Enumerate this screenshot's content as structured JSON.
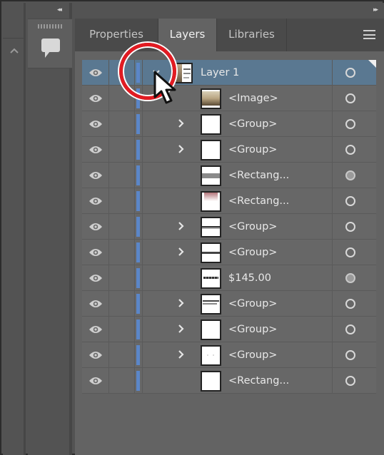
{
  "panel": {
    "collapse_left_icon": "double-chevron-left",
    "expand_right_icon": "double-chevron-right",
    "collapse_left_glyph": "◂◂",
    "expand_right_glyph": "▸▸"
  },
  "side": {
    "comment_icon": "speech-bubble-icon",
    "scroll_up_icon": "chevron-up-icon"
  },
  "tabs": [
    {
      "label": "Properties",
      "active": false
    },
    {
      "label": "Layers",
      "active": true
    },
    {
      "label": "Libraries",
      "active": false
    }
  ],
  "menu_icon": "hamburger-menu-icon",
  "colors": {
    "layer_color": "#5b86c8",
    "selected_row": "#5a7891",
    "callout_red": "#e21b22"
  },
  "layers": [
    {
      "name": "Layer 1",
      "level": "top",
      "expanded": true,
      "visible": true,
      "thumb": "composite",
      "target_filled": false,
      "selected": true
    },
    {
      "name": "<Image>",
      "level": "child",
      "has_children": false,
      "visible": true,
      "thumb": "photo",
      "target_filled": false
    },
    {
      "name": "<Group>",
      "level": "child",
      "has_children": true,
      "visible": true,
      "thumb": "blank",
      "target_filled": false
    },
    {
      "name": "<Group>",
      "level": "child",
      "has_children": true,
      "visible": true,
      "thumb": "blank",
      "target_filled": false
    },
    {
      "name": "<Rectang...",
      "level": "child",
      "has_children": false,
      "visible": true,
      "thumb": "gray-band",
      "target_filled": true
    },
    {
      "name": "<Rectang...",
      "level": "child",
      "has_children": false,
      "visible": true,
      "thumb": "red-gradient",
      "target_filled": false
    },
    {
      "name": "<Group>",
      "level": "child",
      "has_children": true,
      "visible": true,
      "thumb": "dark-line",
      "target_filled": false
    },
    {
      "name": "<Group>",
      "level": "child",
      "has_children": true,
      "visible": true,
      "thumb": "dark-line-2",
      "target_filled": false
    },
    {
      "name": "$145.00",
      "level": "child",
      "has_children": false,
      "visible": true,
      "thumb": "text",
      "target_filled": true
    },
    {
      "name": "<Group>",
      "level": "child",
      "has_children": true,
      "visible": true,
      "thumb": "small-text",
      "target_filled": false
    },
    {
      "name": "<Group>",
      "level": "child",
      "has_children": true,
      "visible": true,
      "thumb": "blank",
      "target_filled": false
    },
    {
      "name": "<Group>",
      "level": "child",
      "has_children": true,
      "visible": true,
      "thumb": "dots",
      "target_filled": false
    },
    {
      "name": "<Rectang...",
      "level": "child",
      "has_children": false,
      "visible": true,
      "thumb": "blank",
      "target_filled": false
    }
  ]
}
